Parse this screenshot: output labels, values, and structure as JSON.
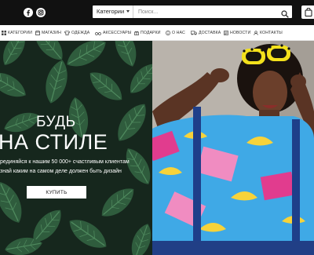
{
  "header": {
    "social": [
      "facebook-icon",
      "instagram-icon"
    ],
    "search": {
      "category_label": "Категории",
      "placeholder": "Поиск..."
    },
    "cart_icon": "shopping-bag-icon"
  },
  "nav": {
    "items": [
      {
        "icon": "grid-icon",
        "label": "КАТЕГОРИИ"
      },
      {
        "icon": "shop-icon",
        "label": "МАГАЗИН"
      },
      {
        "icon": "shirt-icon",
        "label": "ОДЕЖДА"
      },
      {
        "icon": "glasses-icon",
        "label": "АКСЕССУАРЫ"
      },
      {
        "icon": "gift-icon",
        "label": "ПОДАРКИ"
      },
      {
        "icon": "info-icon",
        "label": "О НАС"
      },
      {
        "icon": "truck-icon",
        "label": "ДОСТАВКА"
      },
      {
        "icon": "news-icon",
        "label": "НОВОСТИ"
      },
      {
        "icon": "contacts-icon",
        "label": "КОНТАКТЫ"
      }
    ]
  },
  "hero": {
    "headline_1": "БУДЬ",
    "headline_2": "НА СТИЛЕ",
    "subtext_1": "рединяйся к нашим 50 000+ счастливым клиентам",
    "subtext_2": "знай каким на самом деле должен быть дизайн",
    "button_label": "КУПИТЬ"
  },
  "colors": {
    "topbar": "#111111",
    "hero_left_bg": "#16271d",
    "leaf": "#2f5c3d",
    "shirt": "#3fa9e6"
  }
}
